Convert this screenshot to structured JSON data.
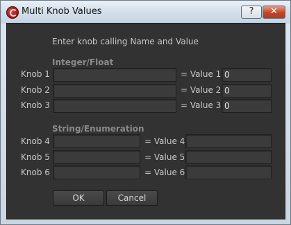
{
  "window": {
    "title": "Multi Knob Values",
    "help_label": "?",
    "close_label": "✕"
  },
  "instruction": "Enter knob calling Name and Value",
  "integer_section": {
    "heading": "Integer/Float",
    "rows": [
      {
        "knob_label": "Knob 1",
        "knob_value": "",
        "value_label": "= Value 1",
        "value": "0"
      },
      {
        "knob_label": "Knob 2",
        "knob_value": "",
        "value_label": "= Value 2",
        "value": "0"
      },
      {
        "knob_label": "Knob 3",
        "knob_value": "",
        "value_label": "= Value 3",
        "value": "0"
      }
    ]
  },
  "string_section": {
    "heading": "String/Enumeration",
    "rows": [
      {
        "knob_label": "Knob 4",
        "knob_value": "",
        "value_label": "= Value 4",
        "value": ""
      },
      {
        "knob_label": "Knob 5",
        "knob_value": "",
        "value_label": "= Value 5",
        "value": ""
      },
      {
        "knob_label": "Knob 6",
        "knob_value": "",
        "value_label": "= Value 6",
        "value": ""
      }
    ]
  },
  "buttons": {
    "ok": "OK",
    "cancel": "Cancel"
  }
}
